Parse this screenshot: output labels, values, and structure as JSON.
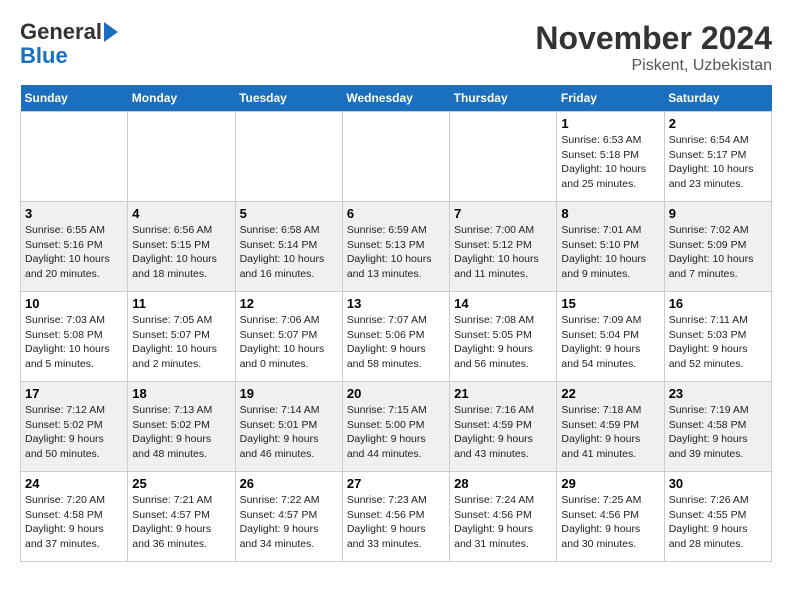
{
  "logo": {
    "line1": "General",
    "line2": "Blue"
  },
  "title": "November 2024",
  "subtitle": "Piskent, Uzbekistan",
  "weekdays": [
    "Sunday",
    "Monday",
    "Tuesday",
    "Wednesday",
    "Thursday",
    "Friday",
    "Saturday"
  ],
  "weeks": [
    [
      {
        "day": "",
        "info": ""
      },
      {
        "day": "",
        "info": ""
      },
      {
        "day": "",
        "info": ""
      },
      {
        "day": "",
        "info": ""
      },
      {
        "day": "",
        "info": ""
      },
      {
        "day": "1",
        "info": "Sunrise: 6:53 AM\nSunset: 5:18 PM\nDaylight: 10 hours and 25 minutes."
      },
      {
        "day": "2",
        "info": "Sunrise: 6:54 AM\nSunset: 5:17 PM\nDaylight: 10 hours and 23 minutes."
      }
    ],
    [
      {
        "day": "3",
        "info": "Sunrise: 6:55 AM\nSunset: 5:16 PM\nDaylight: 10 hours and 20 minutes."
      },
      {
        "day": "4",
        "info": "Sunrise: 6:56 AM\nSunset: 5:15 PM\nDaylight: 10 hours and 18 minutes."
      },
      {
        "day": "5",
        "info": "Sunrise: 6:58 AM\nSunset: 5:14 PM\nDaylight: 10 hours and 16 minutes."
      },
      {
        "day": "6",
        "info": "Sunrise: 6:59 AM\nSunset: 5:13 PM\nDaylight: 10 hours and 13 minutes."
      },
      {
        "day": "7",
        "info": "Sunrise: 7:00 AM\nSunset: 5:12 PM\nDaylight: 10 hours and 11 minutes."
      },
      {
        "day": "8",
        "info": "Sunrise: 7:01 AM\nSunset: 5:10 PM\nDaylight: 10 hours and 9 minutes."
      },
      {
        "day": "9",
        "info": "Sunrise: 7:02 AM\nSunset: 5:09 PM\nDaylight: 10 hours and 7 minutes."
      }
    ],
    [
      {
        "day": "10",
        "info": "Sunrise: 7:03 AM\nSunset: 5:08 PM\nDaylight: 10 hours and 5 minutes."
      },
      {
        "day": "11",
        "info": "Sunrise: 7:05 AM\nSunset: 5:07 PM\nDaylight: 10 hours and 2 minutes."
      },
      {
        "day": "12",
        "info": "Sunrise: 7:06 AM\nSunset: 5:07 PM\nDaylight: 10 hours and 0 minutes."
      },
      {
        "day": "13",
        "info": "Sunrise: 7:07 AM\nSunset: 5:06 PM\nDaylight: 9 hours and 58 minutes."
      },
      {
        "day": "14",
        "info": "Sunrise: 7:08 AM\nSunset: 5:05 PM\nDaylight: 9 hours and 56 minutes."
      },
      {
        "day": "15",
        "info": "Sunrise: 7:09 AM\nSunset: 5:04 PM\nDaylight: 9 hours and 54 minutes."
      },
      {
        "day": "16",
        "info": "Sunrise: 7:11 AM\nSunset: 5:03 PM\nDaylight: 9 hours and 52 minutes."
      }
    ],
    [
      {
        "day": "17",
        "info": "Sunrise: 7:12 AM\nSunset: 5:02 PM\nDaylight: 9 hours and 50 minutes."
      },
      {
        "day": "18",
        "info": "Sunrise: 7:13 AM\nSunset: 5:02 PM\nDaylight: 9 hours and 48 minutes."
      },
      {
        "day": "19",
        "info": "Sunrise: 7:14 AM\nSunset: 5:01 PM\nDaylight: 9 hours and 46 minutes."
      },
      {
        "day": "20",
        "info": "Sunrise: 7:15 AM\nSunset: 5:00 PM\nDaylight: 9 hours and 44 minutes."
      },
      {
        "day": "21",
        "info": "Sunrise: 7:16 AM\nSunset: 4:59 PM\nDaylight: 9 hours and 43 minutes."
      },
      {
        "day": "22",
        "info": "Sunrise: 7:18 AM\nSunset: 4:59 PM\nDaylight: 9 hours and 41 minutes."
      },
      {
        "day": "23",
        "info": "Sunrise: 7:19 AM\nSunset: 4:58 PM\nDaylight: 9 hours and 39 minutes."
      }
    ],
    [
      {
        "day": "24",
        "info": "Sunrise: 7:20 AM\nSunset: 4:58 PM\nDaylight: 9 hours and 37 minutes."
      },
      {
        "day": "25",
        "info": "Sunrise: 7:21 AM\nSunset: 4:57 PM\nDaylight: 9 hours and 36 minutes."
      },
      {
        "day": "26",
        "info": "Sunrise: 7:22 AM\nSunset: 4:57 PM\nDaylight: 9 hours and 34 minutes."
      },
      {
        "day": "27",
        "info": "Sunrise: 7:23 AM\nSunset: 4:56 PM\nDaylight: 9 hours and 33 minutes."
      },
      {
        "day": "28",
        "info": "Sunrise: 7:24 AM\nSunset: 4:56 PM\nDaylight: 9 hours and 31 minutes."
      },
      {
        "day": "29",
        "info": "Sunrise: 7:25 AM\nSunset: 4:56 PM\nDaylight: 9 hours and 30 minutes."
      },
      {
        "day": "30",
        "info": "Sunrise: 7:26 AM\nSunset: 4:55 PM\nDaylight: 9 hours and 28 minutes."
      }
    ]
  ]
}
